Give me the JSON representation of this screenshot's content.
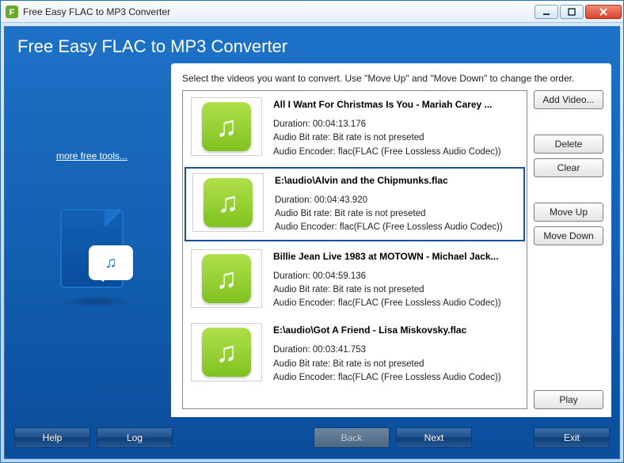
{
  "window": {
    "title": "Free Easy FLAC to MP3 Converter"
  },
  "app": {
    "title": "Free Easy FLAC to MP3 Converter",
    "more_tools": "more free tools..."
  },
  "panel": {
    "instruction": "Select the videos you want to convert. Use \"Move Up\" and \"Move Down\" to change the order."
  },
  "buttons": {
    "add_video": "Add Video...",
    "delete": "Delete",
    "clear": "Clear",
    "move_up": "Move Up",
    "move_down": "Move Down",
    "play": "Play",
    "help": "Help",
    "log": "Log",
    "back": "Back",
    "next": "Next",
    "exit": "Exit"
  },
  "items": [
    {
      "title": "All I Want For Christmas Is You - Mariah Carey ...",
      "duration": "Duration: 00:04:13.176",
      "bitrate": "Audio Bit rate: Bit rate is not preseted",
      "encoder": "Audio Encoder: flac(FLAC (Free Lossless Audio Codec))",
      "selected": false
    },
    {
      "title": "E:\\audio\\Alvin and the Chipmunks.flac",
      "duration": "Duration: 00:04:43.920",
      "bitrate": "Audio Bit rate: Bit rate is not preseted",
      "encoder": "Audio Encoder: flac(FLAC (Free Lossless Audio Codec))",
      "selected": true
    },
    {
      "title": "Billie Jean Live 1983 at MOTOWN - Michael Jack...",
      "duration": "Duration: 00:04:59.136",
      "bitrate": "Audio Bit rate: Bit rate is not preseted",
      "encoder": "Audio Encoder: flac(FLAC (Free Lossless Audio Codec))",
      "selected": false
    },
    {
      "title": "E:\\audio\\Got A Friend - Lisa Miskovsky.flac",
      "duration": "Duration: 00:03:41.753",
      "bitrate": "Audio Bit rate: Bit rate is not preseted",
      "encoder": "Audio Encoder: flac(FLAC (Free Lossless Audio Codec))",
      "selected": false
    }
  ]
}
